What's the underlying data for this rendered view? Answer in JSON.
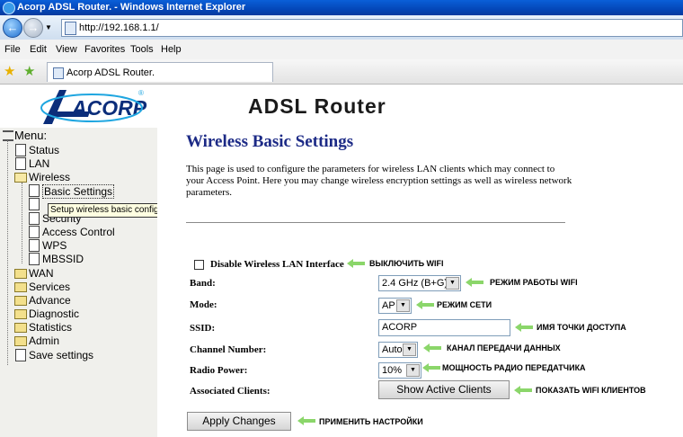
{
  "window": {
    "title": "Acorp ADSL Router. - Windows Internet Explorer"
  },
  "address": {
    "url": "http://192.168.1.1/"
  },
  "menu": [
    "File",
    "Edit",
    "View",
    "Favorites",
    "Tools",
    "Help"
  ],
  "tab": {
    "label": "Acorp ADSL Router."
  },
  "banner": {
    "logo": "ACORP",
    "title": "ADSL Router"
  },
  "sidebar": {
    "menu_label": "Menu:",
    "items": [
      "Status",
      "LAN",
      "Wireless",
      "Basic Settings",
      "Security",
      "Access Control",
      "WPS",
      "MBSSID",
      "WAN",
      "Services",
      "Advance",
      "Diagnostic",
      "Statistics",
      "Admin",
      "Save settings"
    ],
    "tooltip": "Setup wireless basic configuration"
  },
  "page": {
    "title": "Wireless Basic Settings",
    "description": "This page is used to configure the parameters for wireless LAN clients which may connect to your Access Point. Here you may change wireless encryption settings as well as wireless network parameters.",
    "disable_label": "Disable Wireless LAN Interface",
    "band_label": "Band:",
    "band_value": "2.4 GHz (B+G)",
    "mode_label": "Mode:",
    "mode_value": "AP",
    "ssid_label": "SSID:",
    "ssid_value": "ACORP",
    "channel_label": "Channel Number:",
    "channel_value": "Auto",
    "power_label": "Radio Power:",
    "power_value": "10%",
    "clients_label": "Associated Clients:",
    "clients_button": "Show Active Clients",
    "apply_button": "Apply Changes"
  },
  "annotations": {
    "disable": "ВЫКЛЮЧИТЬ WIFI",
    "band": "РЕЖИМ РАБОТЫ WIFI",
    "mode": "РЕЖИМ СЕТИ",
    "ssid": "ИМЯ ТОЧКИ ДОСТУПА",
    "channel": "КАНАЛ ПЕРЕДАЧИ ДАННЫХ",
    "power": "МОЩНОСТЬ РАДИО ПЕРЕДАТЧИКА",
    "clients": "ПОКАЗАТЬ WIFI КЛИЕНТОВ",
    "apply": "ПРИМЕНИТЬ НАСТРОЙКИ"
  },
  "colors": {
    "title_blue": "#1c2a86",
    "sidebar_bg": "#f0f0ec",
    "annotation_arrow": "#8bd66a"
  }
}
